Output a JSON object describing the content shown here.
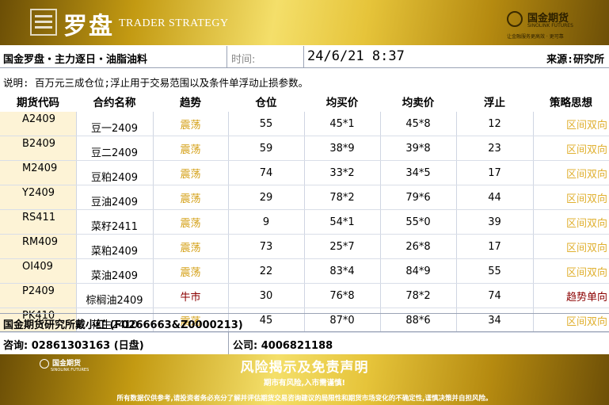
{
  "header": {
    "brand_cn": "罗盘",
    "brand_en": "TRADER STRATEGY",
    "company_cn": "国金期货",
    "company_en": "SINOLINK FUTURES",
    "company_slogan": "让金融服务更高效 · 更可靠"
  },
  "info": {
    "title": "国金罗盘・主力逐日・油脂油料",
    "time_label": "时间:",
    "time_value": "24/6/21 8:37",
    "source": "来源:研究所"
  },
  "note": "说明: 百万元三成仓位;浮止用于交易范围以及条件单浮动止损参数。",
  "table": {
    "headers": [
      "期货代码",
      "合约名称",
      "趋势",
      "仓位",
      "均买价",
      "均卖价",
      "浮止",
      "策略思想"
    ],
    "rows": [
      {
        "code": "A2409",
        "name": "豆一2409",
        "trend": "震荡",
        "position": "55",
        "buy": "45*1",
        "sell": "45*8",
        "stop": "12",
        "strategy": "区间双向",
        "up": false
      },
      {
        "code": "B2409",
        "name": "豆二2409",
        "trend": "震荡",
        "position": "59",
        "buy": "38*9",
        "sell": "39*8",
        "stop": "23",
        "strategy": "区间双向",
        "up": false
      },
      {
        "code": "M2409",
        "name": "豆粕2409",
        "trend": "震荡",
        "position": "74",
        "buy": "33*2",
        "sell": "34*5",
        "stop": "17",
        "strategy": "区间双向",
        "up": false
      },
      {
        "code": "Y2409",
        "name": "豆油2409",
        "trend": "震荡",
        "position": "29",
        "buy": "78*2",
        "sell": "79*6",
        "stop": "44",
        "strategy": "区间双向",
        "up": false
      },
      {
        "code": "RS411",
        "name": "菜籽2411",
        "trend": "震荡",
        "position": "9",
        "buy": "54*1",
        "sell": "55*0",
        "stop": "39",
        "strategy": "区间双向",
        "up": false
      },
      {
        "code": "RM409",
        "name": "菜粕2409",
        "trend": "震荡",
        "position": "73",
        "buy": "25*7",
        "sell": "26*8",
        "stop": "17",
        "strategy": "区间双向",
        "up": false
      },
      {
        "code": "OI409",
        "name": "菜油2409",
        "trend": "震荡",
        "position": "22",
        "buy": "83*4",
        "sell": "84*9",
        "stop": "55",
        "strategy": "区间双向",
        "up": false
      },
      {
        "code": "P2409",
        "name": "棕榈油2409",
        "trend": "牛市",
        "position": "30",
        "buy": "76*8",
        "sell": "78*2",
        "stop": "74",
        "strategy": "趋势单向",
        "up": true
      },
      {
        "code": "PK410",
        "name": "花生2410",
        "trend": "震荡",
        "position": "45",
        "buy": "87*0",
        "sell": "88*6",
        "stop": "34",
        "strategy": "区间双向",
        "up": false
      }
    ]
  },
  "analyst": "国金期货研究所戴小红 (F0266663&Z0000213)",
  "contact": {
    "consult": "咨询: 02861303163 (日盘)",
    "company": "公司: 4006821188"
  },
  "footer": {
    "logo_cn": "国金期货",
    "logo_en": "SINOLINK FUTURES",
    "title": "风险揭示及免责声明",
    "subtitle": "期市有风险,入市需谨慎!",
    "disclaimer": "所有数据仅供参考,请投资者务必充分了解并评估期货交易咨询建议的局限性和期货市场变化的不确定性,谨慎决策并自担风险。"
  }
}
